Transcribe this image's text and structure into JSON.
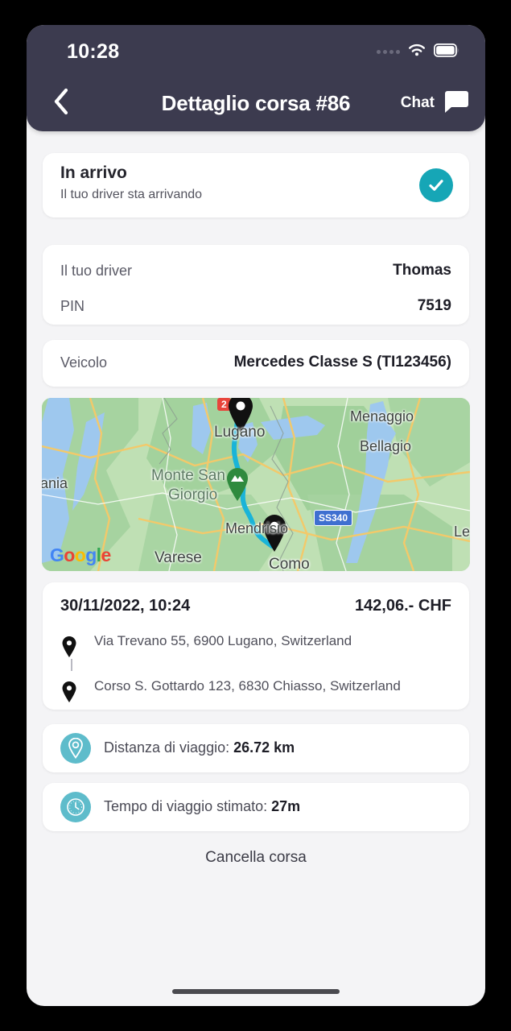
{
  "statusbar": {
    "time": "10:28",
    "signal_icon": "signal-dots-icon",
    "wifi_icon": "wifi-icon",
    "battery_icon": "battery-icon"
  },
  "header": {
    "back_icon": "chevron-left-icon",
    "title": "Dettaglio corsa #86",
    "chat_label": "Chat",
    "chat_icon": "chat-bubble-icon",
    "background_color": "#3c3b4f"
  },
  "status_card": {
    "title": "In arrivo",
    "subtitle": "Il tuo driver sta arrivando",
    "badge_icon": "check-circle-icon",
    "badge_color": "#16a6b6"
  },
  "driver_card": {
    "rows": [
      {
        "label": "Il tuo driver",
        "value": "Thomas"
      },
      {
        "label": "PIN",
        "value": "7519"
      }
    ]
  },
  "vehicle_card": {
    "label": "Veicolo",
    "value": "Mercedes Classe S (TI123456)"
  },
  "map": {
    "provider_logo": "Google",
    "provider_letters": [
      "G",
      "o",
      "o",
      "g",
      "l",
      "e"
    ],
    "labels": [
      "Lugano",
      "Menaggio",
      "Bellagio",
      "Monte San",
      "Giorgio",
      "Mendrisio",
      "Varese",
      "Como",
      "ania",
      "Le"
    ],
    "route_badge": "2",
    "road_badge": "SS340",
    "pickup_marker_icon": "map-pin-marker",
    "dropoff_marker_icon": "map-pin-marker",
    "poi_marker_icon": "park-pin-marker"
  },
  "trip_card": {
    "datetime": "30/11/2022, 10:24",
    "price": "142,06.- CHF",
    "pickup_address": "Via Trevano 55, 6900 Lugano, Switzerland",
    "dropoff_address": "Corso S. Gottardo 123, 6830 Chiasso, Switzerland",
    "pickup_icon": "location-pin-icon",
    "dropoff_icon": "location-pin-icon"
  },
  "info_rows": [
    {
      "icon": "distance-pin-icon",
      "label": "Distanza di viaggio: ",
      "value": "26.72 km"
    },
    {
      "icon": "clock-icon",
      "label": "Tempo di viaggio stimato: ",
      "value": "27m"
    }
  ],
  "cancel": {
    "label": "Cancella corsa"
  },
  "theme": {
    "page_background": "#f4f4f6",
    "card_background": "#ffffff",
    "accent_teal": "#16a6b6",
    "icon_teal": "#5ebccb"
  }
}
